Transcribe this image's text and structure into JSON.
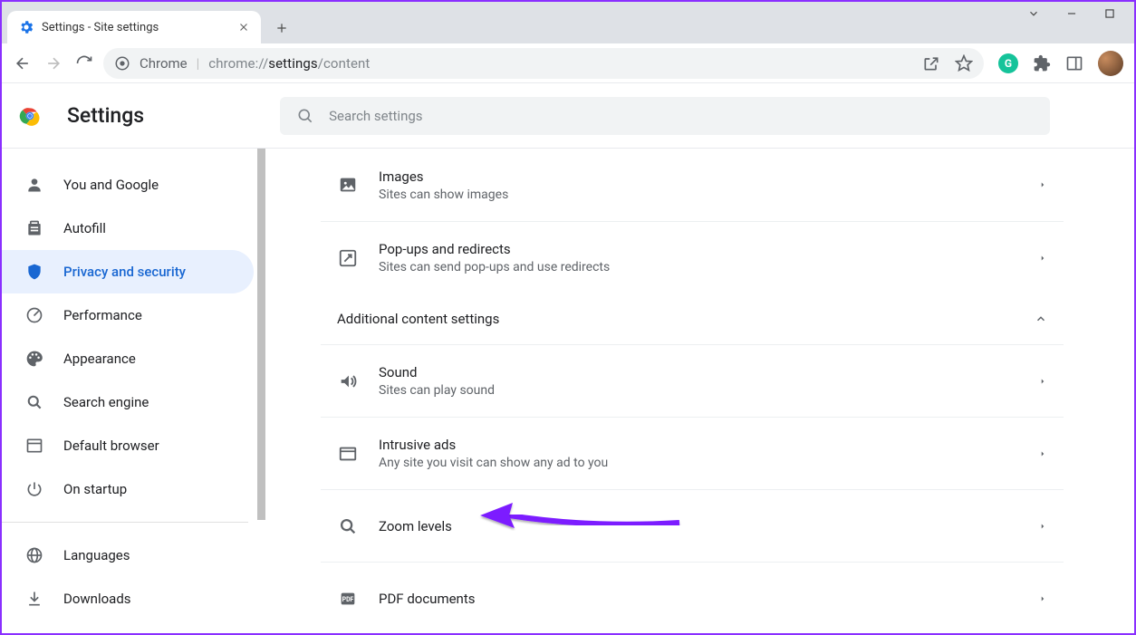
{
  "window": {
    "tab_title": "Settings - Site settings"
  },
  "omnibox": {
    "scheme_label": "Chrome",
    "url_grey_prefix": "chrome://",
    "url_black": "settings",
    "url_grey_suffix": "/content"
  },
  "header": {
    "title": "Settings",
    "search_placeholder": "Search settings"
  },
  "sidebar": {
    "items": [
      {
        "id": "you",
        "label": "You and Google"
      },
      {
        "id": "autofill",
        "label": "Autofill"
      },
      {
        "id": "privacy",
        "label": "Privacy and security"
      },
      {
        "id": "performance",
        "label": "Performance"
      },
      {
        "id": "appearance",
        "label": "Appearance"
      },
      {
        "id": "search",
        "label": "Search engine"
      },
      {
        "id": "default",
        "label": "Default browser"
      },
      {
        "id": "startup",
        "label": "On startup"
      }
    ],
    "secondary": [
      {
        "id": "languages",
        "label": "Languages"
      },
      {
        "id": "downloads",
        "label": "Downloads"
      }
    ]
  },
  "main": {
    "images": {
      "title": "Images",
      "sub": "Sites can show images"
    },
    "popups": {
      "title": "Pop-ups and redirects",
      "sub": "Sites can send pop-ups and use redirects"
    },
    "additional_header": "Additional content settings",
    "sound": {
      "title": "Sound",
      "sub": "Sites can play sound"
    },
    "ads": {
      "title": "Intrusive ads",
      "sub": "Any site you visit can show any ad to you"
    },
    "zoom": {
      "title": "Zoom levels"
    },
    "pdf": {
      "title": "PDF documents"
    }
  }
}
